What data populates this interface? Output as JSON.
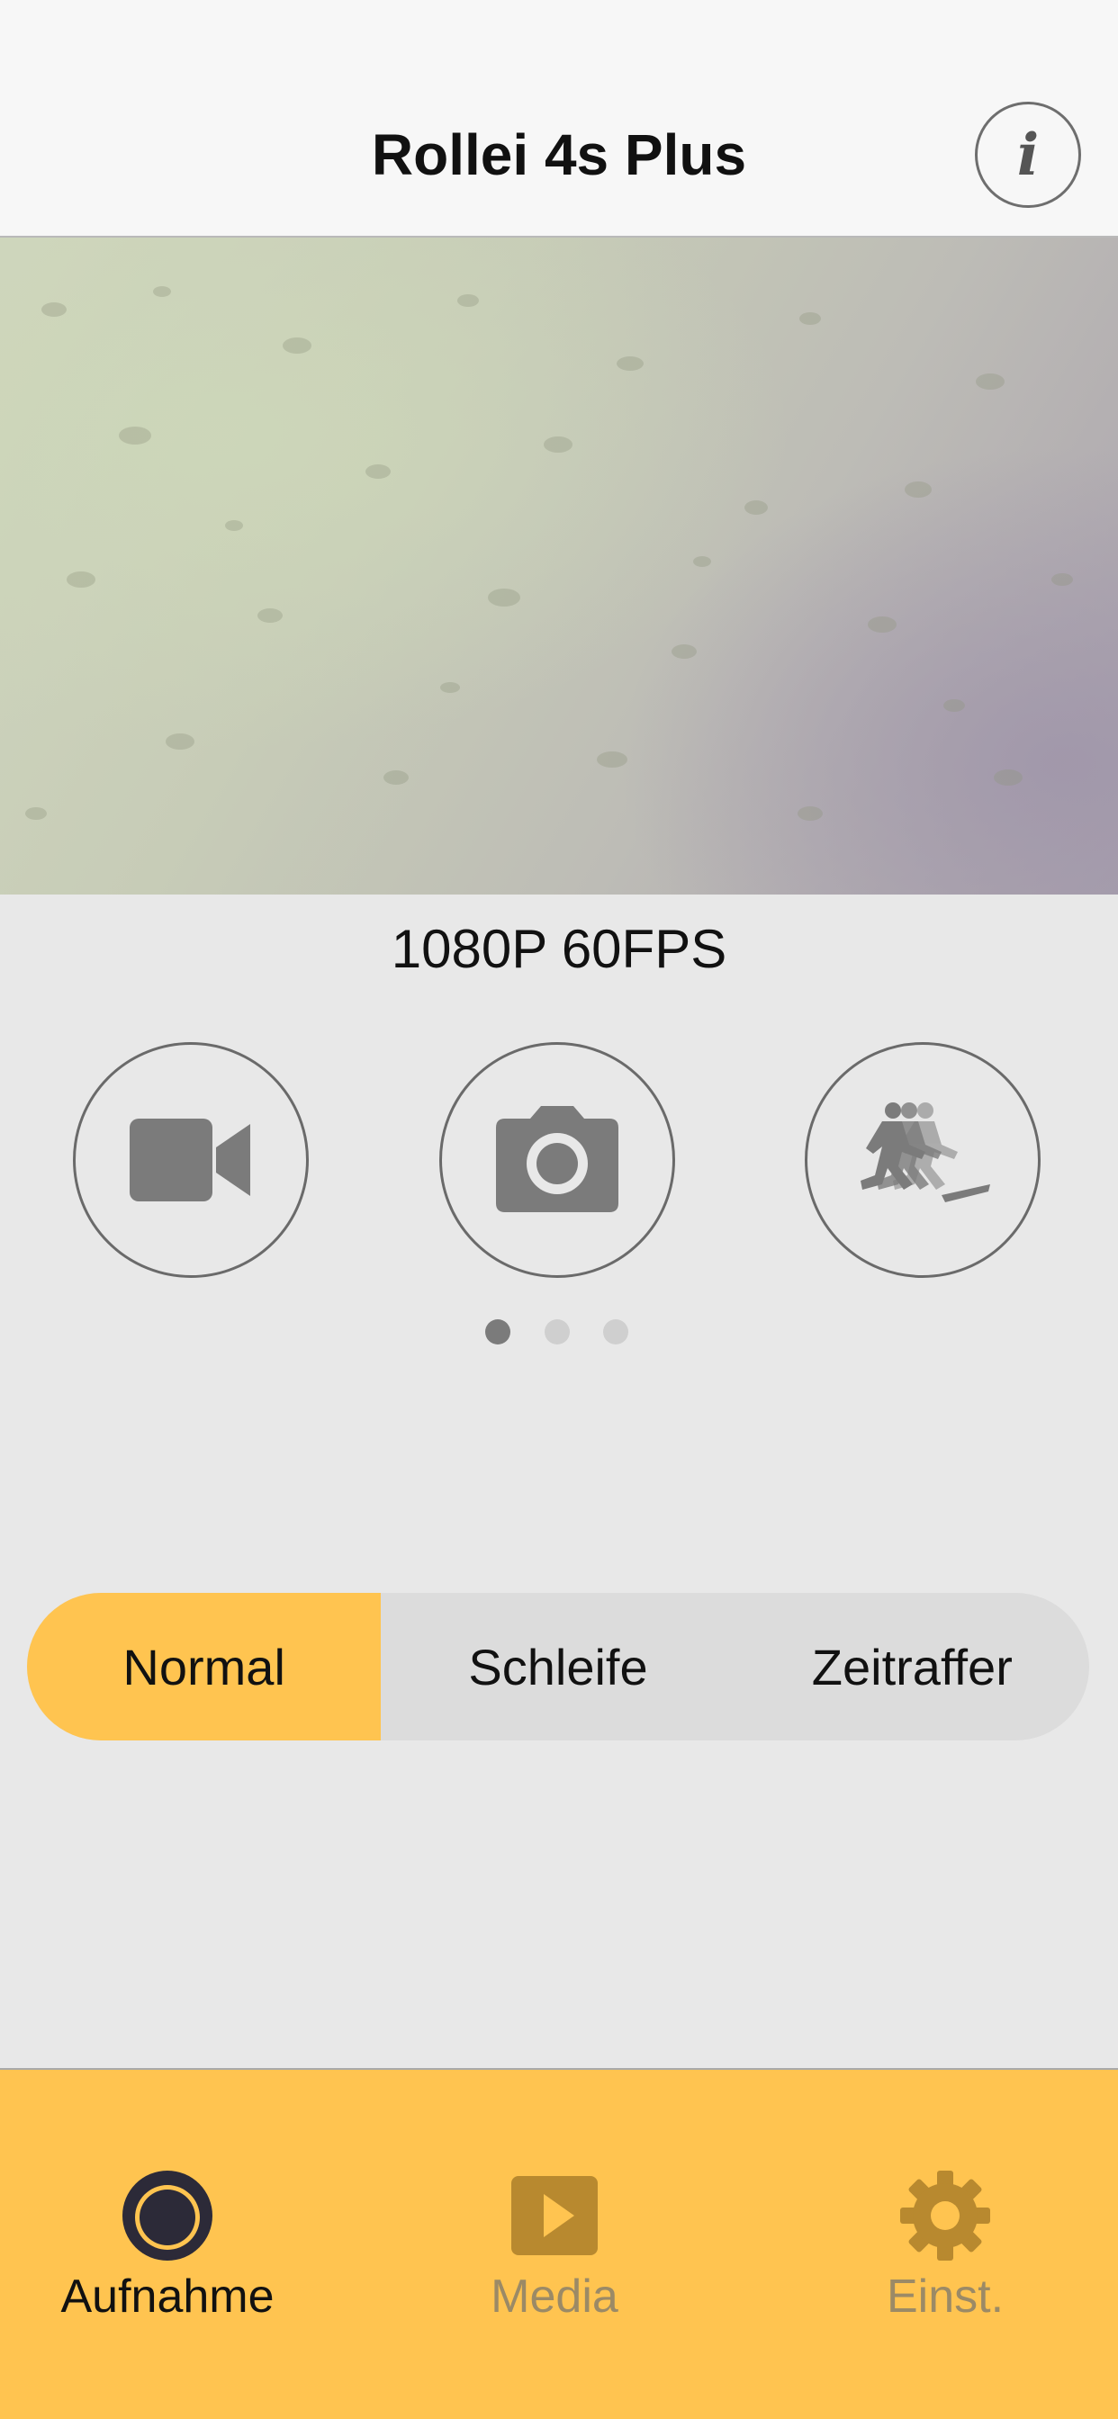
{
  "header": {
    "title": "Rollei 4s Plus",
    "info_label": "i"
  },
  "camera": {
    "resolution": "1080P 60FPS"
  },
  "modes": [
    {
      "icon": "video-camera-icon"
    },
    {
      "icon": "photo-camera-icon"
    },
    {
      "icon": "burst-running-icon"
    }
  ],
  "page_indicator": {
    "count": 3,
    "active": 0
  },
  "segmented": {
    "options": [
      "Normal",
      "Schleife",
      "Zeitraffer"
    ],
    "selected": "Normal"
  },
  "tabbar": {
    "tabs": [
      {
        "label": "Aufnahme",
        "icon": "record-icon",
        "active": true
      },
      {
        "label": "Media",
        "icon": "play-icon",
        "active": false
      },
      {
        "label": "Einst.",
        "icon": "gear-icon",
        "active": false
      }
    ]
  },
  "colors": {
    "accent": "#ffc450",
    "icon_gray": "#7b7b7b",
    "inactive_tab": "#9b8a66"
  }
}
